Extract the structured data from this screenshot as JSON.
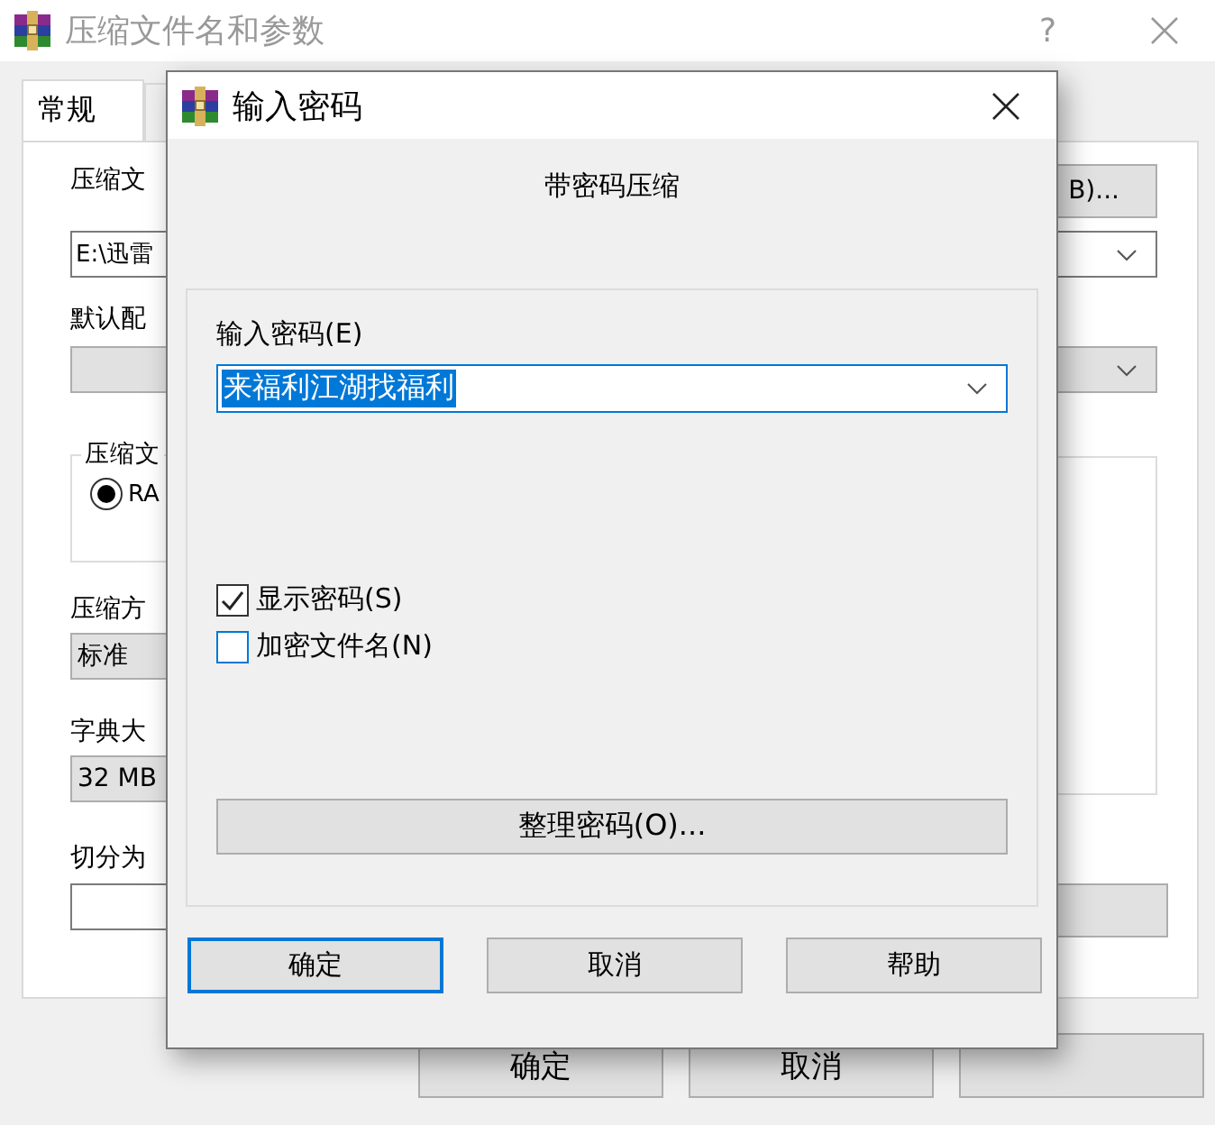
{
  "background_window": {
    "title": "压缩文件名和参数",
    "help_glyph": "?",
    "tabs": [
      {
        "label": "常规",
        "selected": true
      },
      {
        "selected": false
      }
    ],
    "archive_name_label": "压缩文",
    "browse_button": "B)...",
    "archive_name_value": "E:\\迅雷",
    "profile_label": "默认配",
    "format_group_label": "压缩文",
    "format_options": [
      {
        "label": "RA",
        "selected": true
      }
    ],
    "method_label": "压缩方",
    "method_value": "标准",
    "dictionary_label": "字典大",
    "dictionary_value": "32 MB",
    "split_label": "切分为",
    "buttons": [
      {
        "label": "确定"
      },
      {
        "label": "取消"
      },
      {
        "kind": "blank"
      }
    ]
  },
  "password_dialog": {
    "title": "输入密码",
    "heading": "带密码压缩",
    "password_label": "输入密码(E)",
    "password_value": "来福利江湖找福利",
    "password_text_selected": true,
    "checkboxes": [
      {
        "label": "显示密码(S)",
        "checked": true
      },
      {
        "label": "加密文件名(N)",
        "checked": false
      }
    ],
    "organize_button": "整理密码(O)...",
    "buttons": [
      {
        "label": "确定",
        "default": true
      },
      {
        "label": "取消",
        "default": false
      },
      {
        "label": "帮助",
        "default": false
      }
    ]
  }
}
